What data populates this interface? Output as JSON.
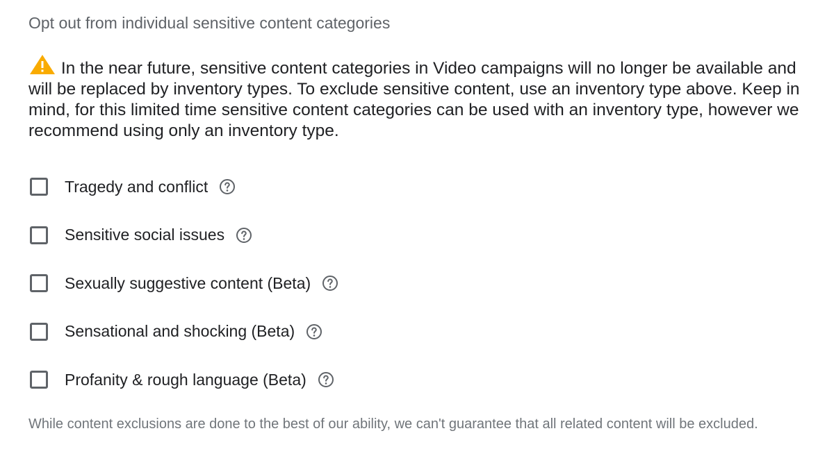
{
  "section": {
    "title": "Opt out from individual sensitive content categories"
  },
  "notice": {
    "icon": "warning-icon",
    "icon_color": "#f9ab00",
    "text": "In the near future, sensitive content categories in Video campaigns will no longer be available and will be replaced by inventory types. To exclude sensitive content, use an inventory type above. Keep in mind, for this limited time sensitive content categories can be used with an inventory type, however we recommend using only an inventory type."
  },
  "categories": [
    {
      "label": "Tragedy and conflict",
      "checked": false
    },
    {
      "label": "Sensitive social issues",
      "checked": false
    },
    {
      "label": "Sexually suggestive content (Beta)",
      "checked": false
    },
    {
      "label": "Sensational and shocking (Beta)",
      "checked": false
    },
    {
      "label": "Profanity & rough language (Beta)",
      "checked": false
    }
  ],
  "disclaimer": "While content exclusions are done to the best of our ability, we can't guarantee that all related content will be excluded."
}
